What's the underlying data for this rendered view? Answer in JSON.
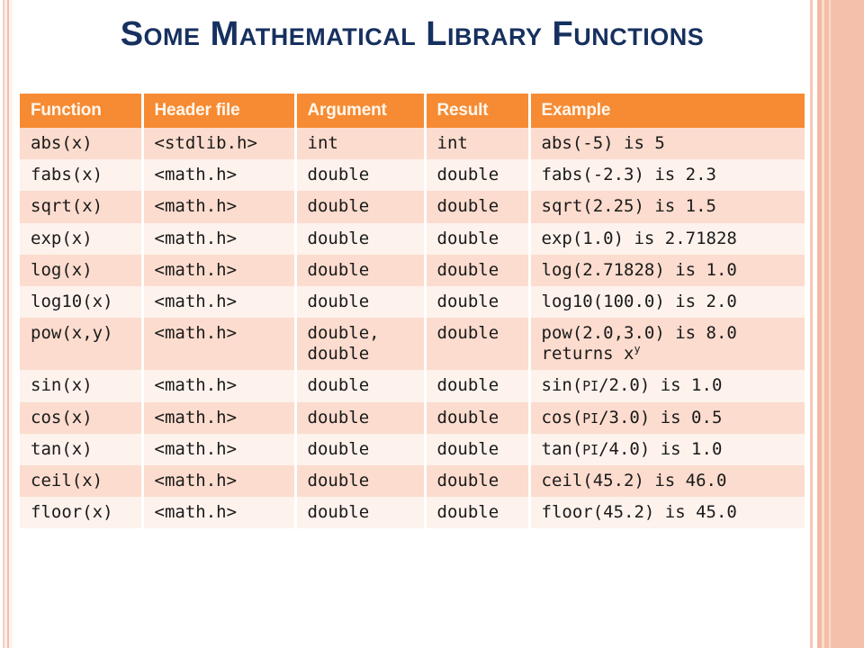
{
  "slide": {
    "title": "Some Mathematical Library Functions",
    "title_color": "#16305F",
    "header_bg": "#F68B33",
    "row_odd_bg": "#FBDCCE",
    "row_even_bg": "#FDF2EC"
  },
  "table": {
    "columns": [
      "Function",
      "Header file",
      "Argument",
      "Result",
      "Example"
    ],
    "rows": [
      {
        "function": "abs(x)",
        "header_file": "<stdlib.h>",
        "argument": "int",
        "result": "int",
        "example": "abs(-5) is 5"
      },
      {
        "function": "fabs(x)",
        "header_file": "<math.h>",
        "argument": "double",
        "result": "double",
        "example": "fabs(-2.3) is 2.3"
      },
      {
        "function": "sqrt(x)",
        "header_file": "<math.h>",
        "argument": "double",
        "result": "double",
        "example": "sqrt(2.25) is 1.5"
      },
      {
        "function": "exp(x)",
        "header_file": "<math.h>",
        "argument": "double",
        "result": "double",
        "example": "exp(1.0) is 2.71828"
      },
      {
        "function": "log(x)",
        "header_file": "<math.h>",
        "argument": "double",
        "result": "double",
        "example": "log(2.71828) is 1.0"
      },
      {
        "function": "log10(x)",
        "header_file": "<math.h>",
        "argument": "double",
        "result": "double",
        "example": "log10(100.0) is 2.0"
      },
      {
        "function": "pow(x,y)",
        "header_file": "<math.h>",
        "argument": "double,\ndouble",
        "result": "double",
        "example_line1": "pow(2.0,3.0) is 8.0",
        "example_line2_prefix": "returns x",
        "example_line2_sup": "y"
      },
      {
        "function": "sin(x)",
        "header_file": "<math.h>",
        "argument": "double",
        "result": "double",
        "example_prefix": "sin(",
        "example_smallcaps": "PI",
        "example_suffix": "/2.0) is 1.0"
      },
      {
        "function": "cos(x)",
        "header_file": "<math.h>",
        "argument": "double",
        "result": "double",
        "example_prefix": "cos(",
        "example_smallcaps": "PI",
        "example_suffix": "/3.0) is 0.5"
      },
      {
        "function": "tan(x)",
        "header_file": "<math.h>",
        "argument": "double",
        "result": "double",
        "example_prefix": "tan(",
        "example_smallcaps": "PI",
        "example_suffix": "/4.0) is 1.0"
      },
      {
        "function": "ceil(x)",
        "header_file": "<math.h>",
        "argument": "double",
        "result": "double",
        "example": "ceil(45.2) is 46.0"
      },
      {
        "function": "floor(x)",
        "header_file": "<math.h>",
        "argument": "double",
        "result": "double",
        "example": "floor(45.2) is 45.0"
      }
    ]
  }
}
